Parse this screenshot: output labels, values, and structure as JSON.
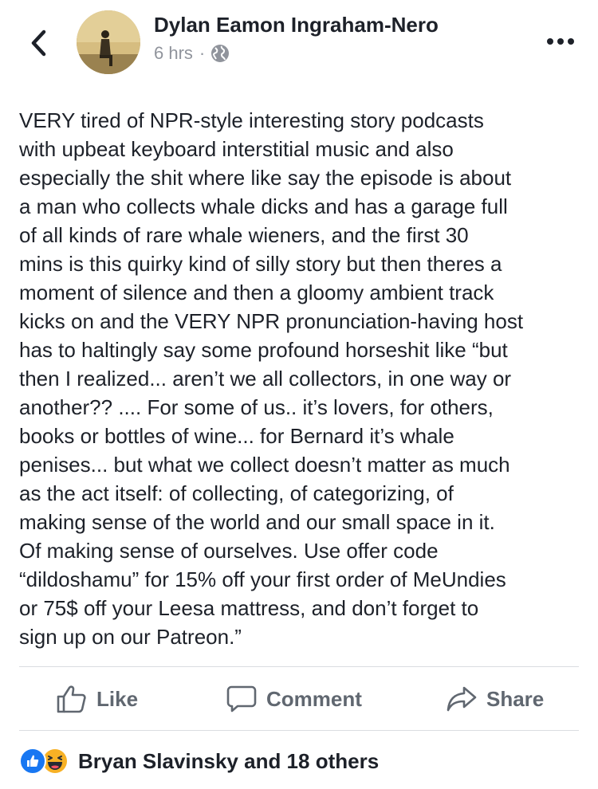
{
  "header": {
    "author_name": "Dylan Eamon Ingraham-Nero",
    "timestamp": "6 hrs",
    "separator": "·",
    "privacy_icon": "globe-icon",
    "back_icon": "chevron-left-icon",
    "more_icon": "ellipsis-icon"
  },
  "post": {
    "lines": [
      "VERY tired of NPR-style interesting story podcasts",
      "with upbeat keyboard interstitial music and also",
      "especially the shit where like say the episode is about",
      "a man who collects whale dicks and has a garage full",
      "of all kinds of rare whale wieners, and the first 30",
      "mins is this quirky kind of silly story but then theres a",
      "moment of silence and then a gloomy ambient track",
      "kicks on and the VERY NPR pronunciation-having host",
      "has to haltingly say some profound horseshit like “but",
      "then I realized... aren’t we all collectors, in one way or",
      "another?? .... For some of us.. it’s lovers, for others,",
      "books or bottles of wine... for Bernard it’s whale",
      "penises... but what we collect doesn’t matter as much",
      "as the act itself: of collecting, of categorizing, of",
      "making sense of the world and our small space in it.",
      "Of making sense of ourselves. Use offer code",
      "“dildoshamu” for 15% off your first order of MeUndies",
      "or 75$ off your Leesa mattress, and don’t forget to",
      "sign up on our Patreon.”"
    ]
  },
  "actions": {
    "like_label": "Like",
    "comment_label": "Comment",
    "share_label": "Share",
    "like_icon": "thumbs-up-icon",
    "comment_icon": "speech-bubble-icon",
    "share_icon": "share-arrow-icon"
  },
  "reactions": {
    "summary": "Bryan Slavinsky and 18 others",
    "icons": [
      "like-reaction-icon",
      "haha-reaction-icon"
    ]
  },
  "colors": {
    "text": "#1d2129",
    "muted": "#90949c",
    "action": "#606770",
    "like_blue": "#1877f2",
    "divider": "#dadde1",
    "haha_yellow": "#f7b125"
  }
}
